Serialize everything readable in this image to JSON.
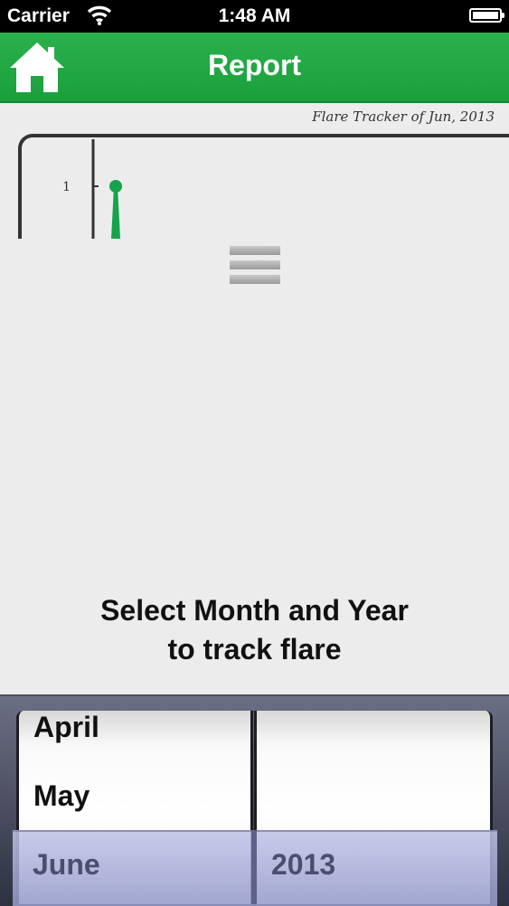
{
  "status_bar": {
    "carrier": "Carrier",
    "time": "1:48 AM"
  },
  "navbar": {
    "title": "Report",
    "home_icon": "home-icon"
  },
  "report": {
    "subtitle": "Flare Tracker of Jun, 2013"
  },
  "chart_data": {
    "type": "bar",
    "categories": [
      ""
    ],
    "values": [
      1
    ],
    "y_ticks": [
      "1"
    ],
    "title": "",
    "xlabel": "",
    "ylabel": "",
    "colors": {
      "bar": "#16a34a",
      "axis": "#333333"
    }
  },
  "prompt": {
    "line1": "Select Month and Year",
    "line2": "to track flare"
  },
  "picker": {
    "months": [
      "April",
      "May",
      "June"
    ],
    "selected_month": "June",
    "selected_year": "2013"
  },
  "colors": {
    "accent": "#1fa844",
    "picker_selection": "#aeb3dc"
  }
}
